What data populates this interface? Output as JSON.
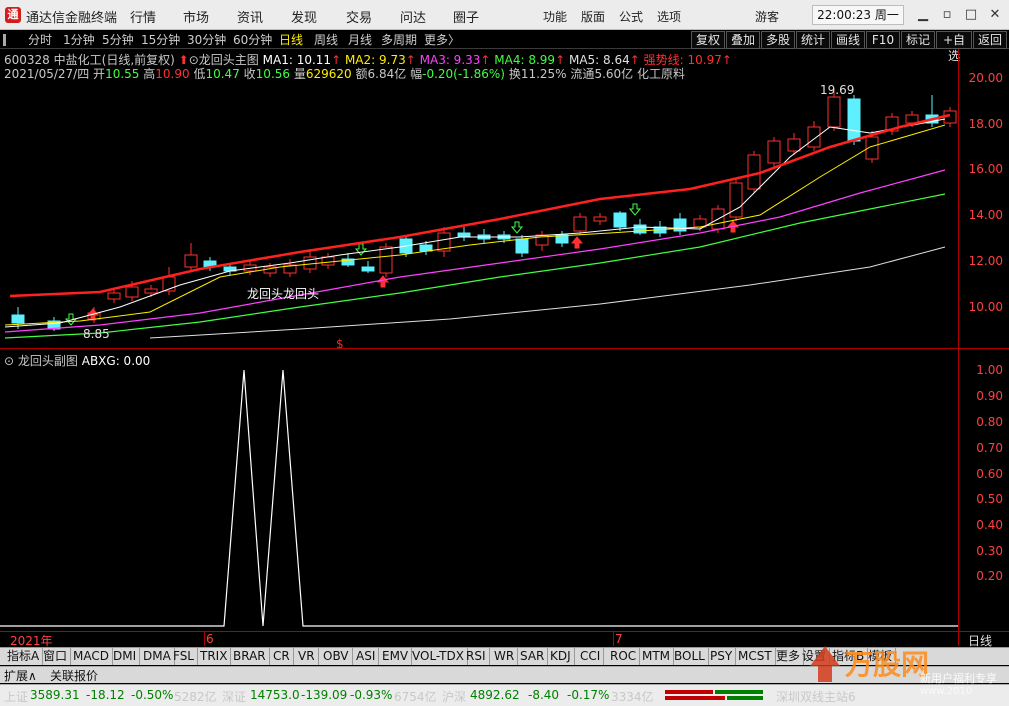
{
  "app": {
    "title": "通达信金融终端",
    "logo": "通",
    "menus": [
      "行情",
      "市场",
      "资讯",
      "发现",
      "交易",
      "问达",
      "圈子"
    ],
    "right_menus": [
      "功能",
      "版面",
      "公式",
      "选项"
    ],
    "user": "游客",
    "clock": "22:00:23 周一"
  },
  "periods": [
    "分时",
    "1分钟",
    "5分钟",
    "15分钟",
    "30分钟",
    "60分钟",
    "日线",
    "周线",
    "月线",
    "多周期",
    "更多〉"
  ],
  "right_buttons": [
    "复权",
    "叠加",
    "多股",
    "统计",
    "画线",
    "F10",
    "标记",
    "+自选",
    "返回"
  ],
  "stock": {
    "code": "600328",
    "name": "中盐化工",
    "mode": "(日线,前复权)",
    "formula": "龙回头主图",
    "ma": [
      {
        "label": "MA1: 10.11",
        "color": "#ffffff"
      },
      {
        "label": "MA2: 9.73",
        "color": "#ffee00"
      },
      {
        "label": "MA3: 9.33",
        "color": "#ff40ff"
      },
      {
        "label": "MA4: 8.99",
        "color": "#40ff40"
      },
      {
        "label": "MA5: 8.64",
        "color": "#e0e0e0"
      },
      {
        "label": "强势线: 10.97",
        "color": "#ff3030"
      }
    ],
    "date": "2021/05/27/四",
    "open_l": "开",
    "open": "10.55",
    "high_l": "高",
    "high": "10.90",
    "low_l": "低",
    "low": "10.47",
    "close_l": "收",
    "close": "10.56",
    "vol_l": "量",
    "vol": "629620",
    "amt_l": "额",
    "amt": "6.84亿",
    "chg_l": "幅",
    "chg": "-0.20(-1.86%)",
    "turn_l": "换",
    "turn": "11.25%",
    "float_l": "流通",
    "float": "5.60亿",
    "sector": "化工原料"
  },
  "annotations": {
    "max": "19.69",
    "min": "8.85",
    "label1": "龙回头",
    "label2": "龙回头",
    "dollar": "$"
  },
  "yaxis_main": [
    "20.00",
    "18.00",
    "16.00",
    "14.00",
    "12.00",
    "10.00"
  ],
  "sub": {
    "title": "龙回头副图",
    "value": "ABXG: 0.00",
    "yaxis": [
      "1.00",
      "0.90",
      "0.80",
      "0.70",
      "0.60",
      "0.50",
      "0.40",
      "0.30",
      "0.20"
    ]
  },
  "dates": [
    "2021年",
    "6",
    "7"
  ],
  "period_label": "日线",
  "tabs": [
    "指标A",
    "窗口",
    "MACD",
    "DMI",
    "DMA",
    "FSL",
    "TRIX",
    "BRAR",
    "CR",
    "VR",
    "OBV",
    "ASI",
    "EMV",
    "VOL-TDX",
    "RSI",
    "WR",
    "SAR",
    "KDJ",
    "CCI",
    "ROC",
    "MTM",
    "BOLL",
    "PSY",
    "MCST",
    "更多",
    "设置",
    "指标B",
    "模板"
  ],
  "ext": [
    "扩展∧",
    "关联报价"
  ],
  "status": {
    "sh_l": "上证",
    "sh": "3589.31",
    "sh_chg": "-18.12",
    "sh_pct": "-0.50%",
    "sh_amt": "5282亿",
    "sz_l": "深证",
    "sz": "14753.0",
    "sz_chg": "-139.09",
    "sz_pct": "-0.93%",
    "sz_amt": "6754亿",
    "hs_l": "沪深",
    "hs": "4892.62",
    "hs_chg": "-8.40",
    "hs_pct": "-0.17%",
    "hs_amt": "3334亿",
    "server": "深圳双线主站6"
  },
  "watermark": {
    "brand": "万股网",
    "tag": "新用户福利专享",
    "url": "www.2010",
    "sub": "2010"
  }
}
